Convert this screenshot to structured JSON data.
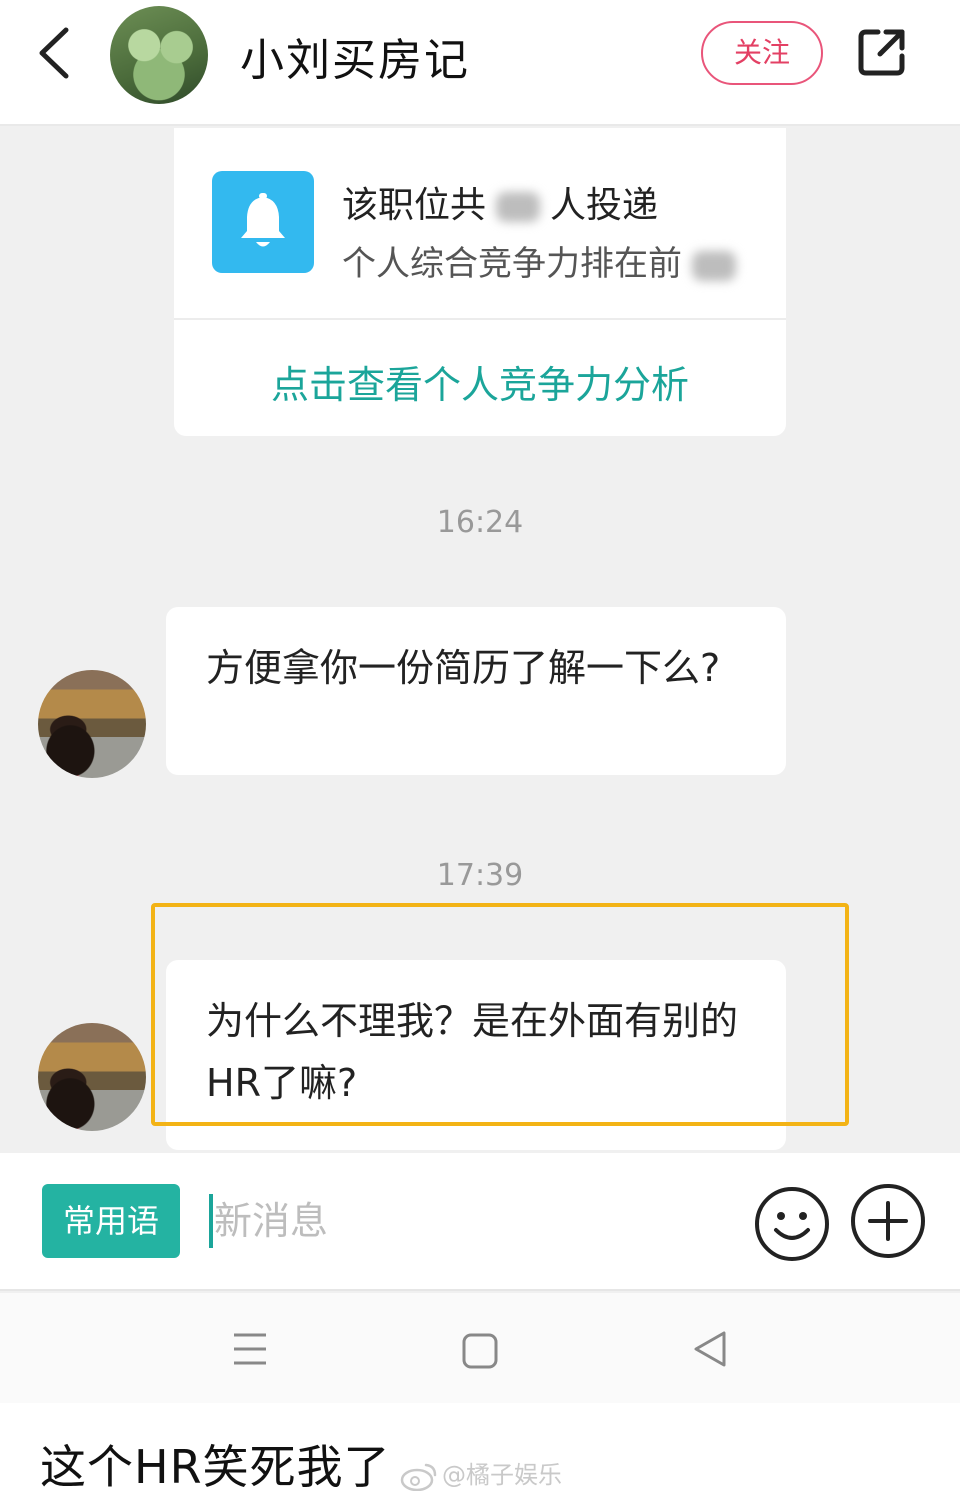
{
  "header": {
    "title": "小刘买房记",
    "follow_label": "关注"
  },
  "rank_card": {
    "line1_prefix": "该职位共",
    "line1_suffix": "人投递",
    "line2_prefix": "个人综合竞争力排在前",
    "link_label": "点击查看个人竞争力分析"
  },
  "messages": [
    {
      "time": "16:24",
      "text": "方便拿你一份简历了解一下么?"
    },
    {
      "time": "17:39",
      "text": "为什么不理我？是在外面有别的HR了嘛?"
    }
  ],
  "input_bar": {
    "phrases_label": "常用语",
    "placeholder": "新消息"
  },
  "caption": {
    "text": "这个HR笑死我了",
    "watermark": "@橘子娱乐"
  },
  "colors": {
    "accent_teal": "#24b3a2",
    "follow_red": "#e34064",
    "bell_blue": "#33b9ef",
    "highlight_yellow": "#f3b315"
  },
  "icons": [
    "back-arrow-icon",
    "share-icon",
    "bell-icon",
    "emoji-icon",
    "plus-icon",
    "menu-icon",
    "home-icon",
    "nav-back-icon",
    "weibo-icon"
  ]
}
